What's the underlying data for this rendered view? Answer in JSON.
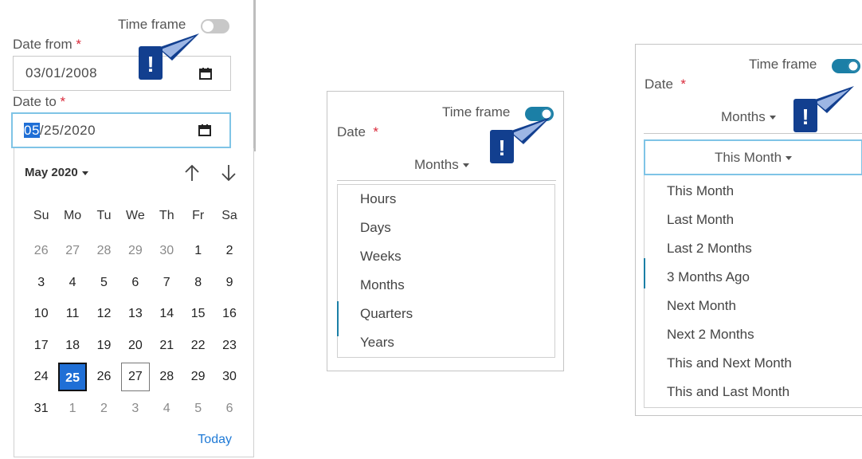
{
  "panel1": {
    "time_frame_label": "Time frame",
    "date_from_label": "Date from",
    "date_to_label": "Date to",
    "required_mark": "*",
    "date_from_value": "03/01/2008",
    "date_to_selected": "05",
    "date_to_rest": "/25/2020",
    "calendar": {
      "month_label": "May 2020",
      "weekdays": [
        "Su",
        "Mo",
        "Tu",
        "We",
        "Th",
        "Fr",
        "Sa"
      ],
      "weeks": [
        [
          "26",
          "27",
          "28",
          "29",
          "30",
          "1",
          "2"
        ],
        [
          "3",
          "4",
          "5",
          "6",
          "7",
          "8",
          "9"
        ],
        [
          "10",
          "11",
          "12",
          "13",
          "14",
          "15",
          "16"
        ],
        [
          "17",
          "18",
          "19",
          "20",
          "21",
          "22",
          "23"
        ],
        [
          "24",
          "25",
          "26",
          "27",
          "28",
          "29",
          "30"
        ],
        [
          "31",
          "1",
          "2",
          "3",
          "4",
          "5",
          "6"
        ]
      ],
      "today_label": "Today"
    }
  },
  "panel2": {
    "time_frame_label": "Time frame",
    "date_label": "Date",
    "required_mark": "*",
    "unit_value": "Months",
    "options": [
      "Hours",
      "Days",
      "Weeks",
      "Months",
      "Quarters",
      "Years"
    ]
  },
  "panel3": {
    "time_frame_label": "Time frame",
    "date_label": "Date",
    "required_mark": "*",
    "unit_value": "Months",
    "range_value": "This Month",
    "options": [
      "This Month",
      "Last Month",
      "Last 2 Months",
      "3 Months Ago",
      "Next Month",
      "Next 2 Months",
      "This and Next Month",
      "This and Last Month"
    ]
  },
  "colors": {
    "toggle_on": "#1b7fa6",
    "toggle_off": "#c8c8c8",
    "alert": "#123f8f",
    "required": "#d9293a",
    "selected_day": "#1f6fd6",
    "link": "#1f7ad6"
  }
}
